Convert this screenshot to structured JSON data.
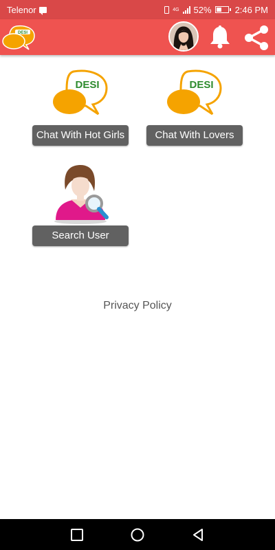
{
  "status_bar": {
    "carrier": "Telenor",
    "battery_percent": "52%",
    "battery_level": 0.52,
    "time": "2:46 PM",
    "network_tag": "4G",
    "icons": [
      "message-icon",
      "vibrate-icon",
      "signal-icon",
      "battery-icon"
    ]
  },
  "app_bar": {
    "logo": "desi-chat-logo",
    "avatar": "profile-avatar",
    "actions": [
      "bell-icon",
      "share-icon"
    ],
    "color": "#ef5350"
  },
  "tiles": [
    {
      "label": "Chat With Hot Girls",
      "icon": "desi-chat-bubble-icon",
      "logo_text": "DESI"
    },
    {
      "label": "Chat With Lovers",
      "icon": "desi-chat-bubble-icon",
      "logo_text": "DESI"
    },
    {
      "label": "Search User",
      "icon": "search-user-icon"
    }
  ],
  "privacy_policy": "Privacy Policy",
  "nav_bar": {
    "buttons": [
      "recents-square-icon",
      "home-circle-icon",
      "back-triangle-icon"
    ]
  },
  "colors": {
    "status_bar": "#d94848",
    "button": "#616161",
    "bubble_orange": "#f5a300",
    "desi_green": "#2e8b2e"
  }
}
